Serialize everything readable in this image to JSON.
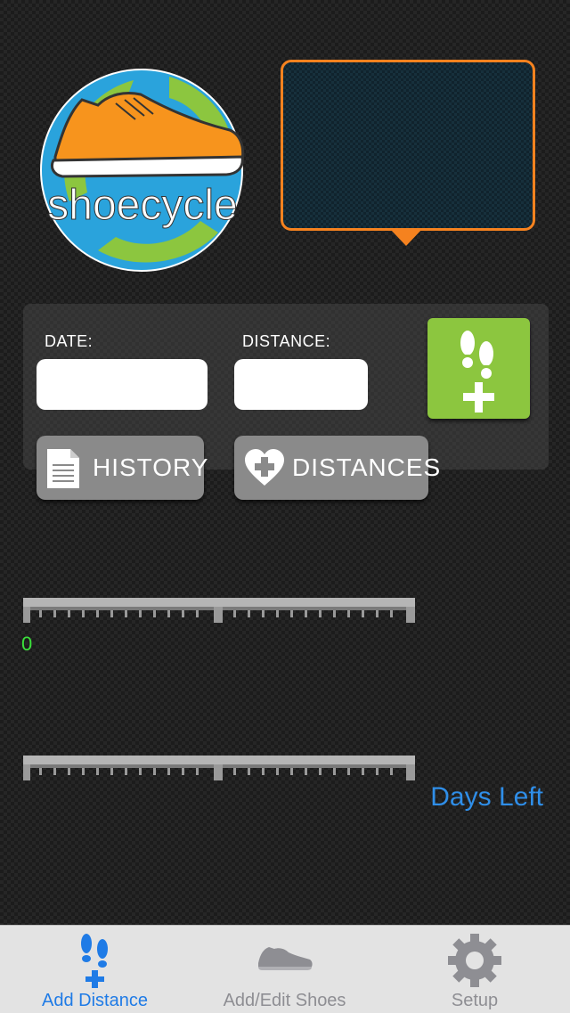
{
  "logo": {
    "text": "shoecycle"
  },
  "form": {
    "date_label": "DATE:",
    "date_value": "",
    "distance_label": "DISTANCE:",
    "distance_value": ""
  },
  "buttons": {
    "history_label": "HISTORY",
    "distances_label": "DISTANCES"
  },
  "progress": {
    "distance_start_label": "0",
    "days_left_label": "Days Left"
  },
  "tabs": [
    {
      "label": "Add Distance",
      "icon": "footsteps-plus-icon",
      "selected": true
    },
    {
      "label": "Add/Edit Shoes",
      "icon": "shoe-icon",
      "selected": false
    },
    {
      "label": "Setup",
      "icon": "gear-icon",
      "selected": false
    }
  ],
  "colors": {
    "accent_orange": "#f5821f",
    "accent_green": "#8cc63f",
    "selected_tab": "#1f7be6",
    "unselected_tab": "#8e8e93",
    "days_left": "#2f8ee8",
    "zero_label": "#3be23b"
  }
}
